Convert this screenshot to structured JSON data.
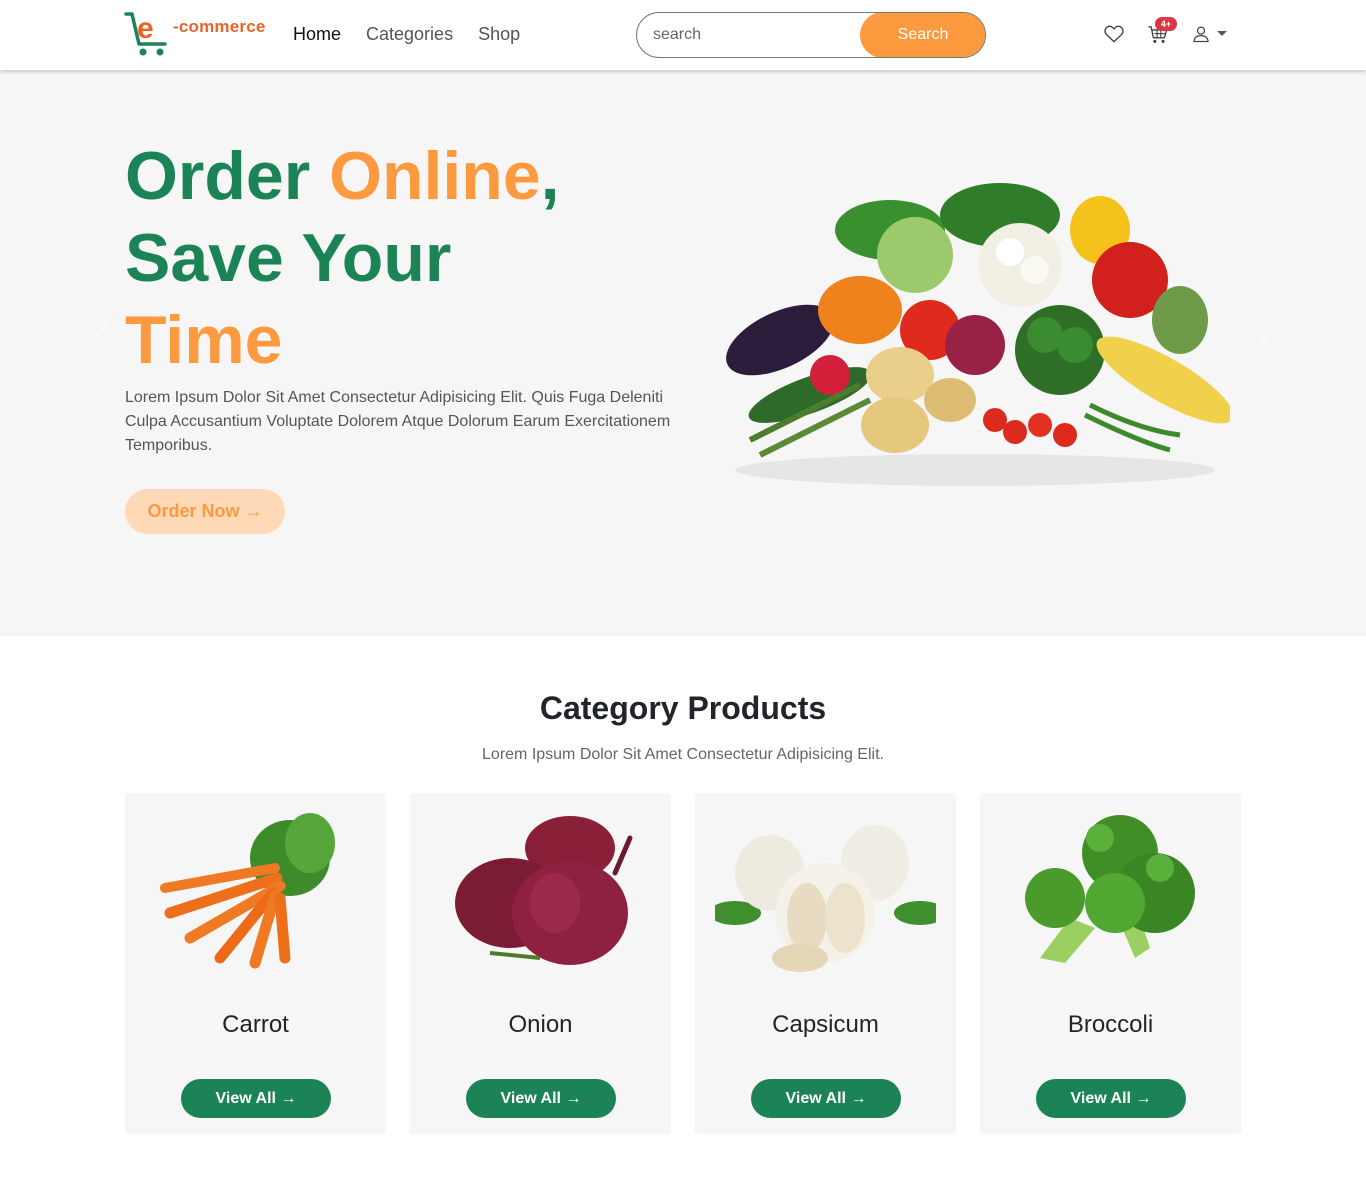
{
  "brand": {
    "logo_text": "-commerce",
    "logo_letter": "e"
  },
  "nav": {
    "links": [
      "Home",
      "Categories",
      "Shop"
    ],
    "active": "Home"
  },
  "search": {
    "placeholder": "search",
    "button_label": "Search"
  },
  "header_icons": {
    "wishlist": "heart-icon",
    "cart": "cart-icon",
    "cart_badge": "4+",
    "account": "user-icon"
  },
  "hero": {
    "title_part1": "Order ",
    "title_part2": "Online",
    "title_part3": ",",
    "title_part4": "Save Your",
    "title_part5": "Time",
    "description": "Lorem Ipsum Dolor Sit Amet Consectetur Adipisicing Elit. Quis Fuga Deleniti Culpa Accusantium Voluptate Dolorem Atque Dolorum Earum Exercitationem Temporibus.",
    "order_button": "Order Now →",
    "image": "vegetables-basket-image"
  },
  "category": {
    "title": "Category Products",
    "subtitle": "Lorem Ipsum Dolor Sit Amet Consectetur Adipisicing Elit.",
    "items": [
      {
        "name": "Carrot",
        "button": "View All →",
        "image": "carrot-image"
      },
      {
        "name": "Onion",
        "button": "View All →",
        "image": "onion-image"
      },
      {
        "name": "Capsicum",
        "button": "View All →",
        "image": "garlic-image"
      },
      {
        "name": "Broccoli",
        "button": "View All →",
        "image": "broccoli-image"
      }
    ]
  },
  "colors": {
    "green": "#1b8356",
    "orange": "#fd9a3f",
    "badge_red": "#dc3545",
    "hero_bg": "#f6f6f6"
  }
}
